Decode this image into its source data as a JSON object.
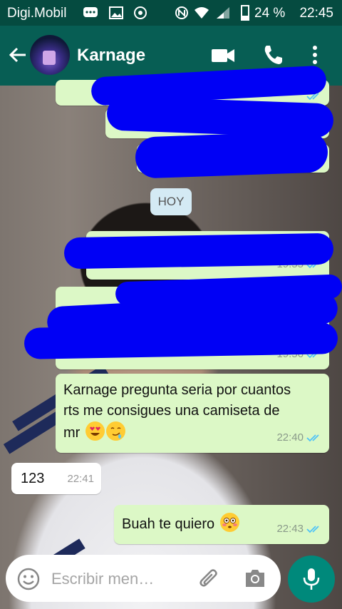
{
  "status_bar": {
    "carrier": "Digi.Mobil",
    "battery": "24 %",
    "time": "22:45"
  },
  "header": {
    "contact_name": "Karnage"
  },
  "chat": {
    "day_label": "HOY",
    "messages": [
      {
        "text": "",
        "time": "",
        "direction": "out",
        "status": "read",
        "redacted": true
      },
      {
        "text": "",
        "time": "",
        "direction": "out",
        "status": "read",
        "redacted": true
      },
      {
        "text": "",
        "time": "",
        "direction": "out",
        "status": "read",
        "redacted": true
      },
      {
        "text": "",
        "time": "19:55",
        "direction": "out",
        "status": "read",
        "redacted": true
      },
      {
        "text": "",
        "time": "19:56",
        "direction": "out",
        "status": "read",
        "redacted": true
      },
      {
        "text": "Karnage pregunta seria por cuantos rts me consigues una camiseta de mr",
        "time": "22:40",
        "direction": "out",
        "status": "read",
        "emoji": [
          "heart-eyes-emoji",
          "drooling-emoji"
        ]
      },
      {
        "text": "123",
        "time": "22:41",
        "direction": "in"
      },
      {
        "text": "Buah te quiero",
        "time": "22:43",
        "direction": "out",
        "status": "read",
        "emoji": [
          "flushed-emoji"
        ]
      }
    ]
  },
  "composer": {
    "placeholder": "Escribir men…"
  },
  "colors": {
    "status_bar": "#054b40",
    "app_bar": "#075e54",
    "outgoing_bubble": "#dcf8c6",
    "incoming_bubble": "#ffffff",
    "read_ticks": "#4fc3f7",
    "mic_button": "#00897b",
    "scribble": "#0000f5"
  }
}
